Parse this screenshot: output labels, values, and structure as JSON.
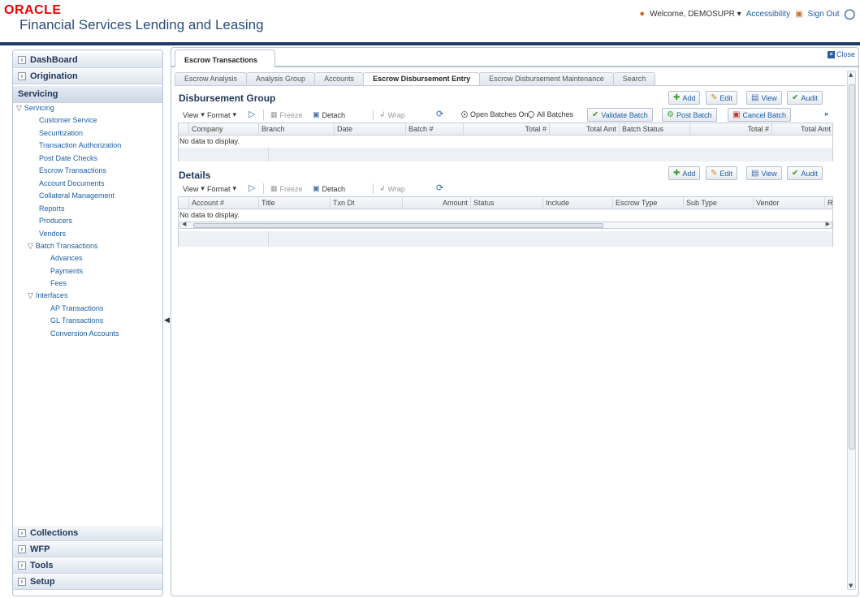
{
  "header": {
    "logo_oracle": "ORACLE",
    "logo_product": "Financial Services Lending and Leasing",
    "welcome": "Welcome, DEMOSUPR",
    "accessibility": "Accessibility",
    "sign_out": "Sign Out"
  },
  "leftnav": {
    "dashboard": "DashBoard",
    "origination": "Origination",
    "servicing_header": "Servicing",
    "servicing_group": "Servicing",
    "items": [
      "Customer Service",
      "Securitization",
      "Transaction Authorization",
      "Post Date Checks",
      "Escrow Transactions",
      "Account Documents",
      "Collateral Management",
      "Reports",
      "Producers",
      "Vendors"
    ],
    "batch_group": "Batch Transactions",
    "batch_items": [
      "Advances",
      "Payments",
      "Fees"
    ],
    "interfaces_group": "Interfaces",
    "interface_items": [
      "AP Transactions",
      "GL Transactions",
      "Conversion Accounts"
    ],
    "collections": "Collections",
    "wfp": "WFP",
    "tools": "Tools",
    "setup": "Setup"
  },
  "main": {
    "tab_title": "Escrow Transactions",
    "close_label": "Close",
    "subtabs": [
      "Escrow Analysis",
      "Analysis Group",
      "Accounts",
      "Escrow Disbursement Entry",
      "Escrow Disbursement Maintenance",
      "Search"
    ],
    "active_subtab": "Escrow Disbursement Entry"
  },
  "disbursement_group": {
    "title": "Disbursement Group",
    "add": "Add",
    "edit": "Edit",
    "view": "View",
    "audit": "Audit",
    "view_menu": "View",
    "format_menu": "Format",
    "freeze": "Freeze",
    "detach": "Detach",
    "wrap": "Wrap",
    "open_batches": "Open Batches Only",
    "all_batches": "All Batches",
    "validate_batch": "Validate Batch",
    "post_batch": "Post Batch",
    "cancel_batch": "Cancel Batch",
    "more": "»",
    "columns": [
      "Company",
      "Branch",
      "Date",
      "Batch #",
      "Total #",
      "Total Amt",
      "Batch Status",
      "Total #",
      "Total Amt"
    ],
    "no_data": "No data to display."
  },
  "details": {
    "title": "Details",
    "add": "Add",
    "edit": "Edit",
    "view": "View",
    "audit": "Audit",
    "view_menu": "View",
    "format_menu": "Format",
    "freeze": "Freeze",
    "detach": "Detach",
    "wrap": "Wrap",
    "columns": [
      "Account #",
      "Title",
      "Txn Dt",
      "Amount",
      "Status",
      "Include",
      "Escrow Type",
      "Sub Type",
      "Vendor",
      "R"
    ],
    "no_data": "No data to display."
  }
}
